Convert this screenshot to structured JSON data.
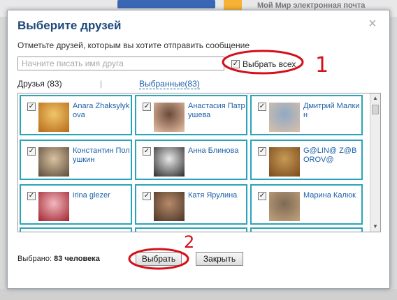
{
  "dialog": {
    "title": "Выберите друзей",
    "close_glyph": "×",
    "subtitle": "Отметьте друзей, которым вы хотите отправить сообщение",
    "search_placeholder": "Начните писать имя друга",
    "select_all_label": "Выбрать всех",
    "tab_friends": "Друзья (83)",
    "tab_separator": "|",
    "tab_selected": "Выбранные(83)"
  },
  "friends": [
    {
      "name": "Anara Zhaksylykova",
      "checked": true,
      "avatar_colors": [
        "#f0c66a",
        "#b86a18"
      ]
    },
    {
      "name": "Анастасия Патрушева",
      "checked": true,
      "avatar_colors": [
        "#6b4a3a",
        "#e8c1a5"
      ]
    },
    {
      "name": "Дмитрий Малкин",
      "checked": true,
      "avatar_colors": [
        "#8fa9c5",
        "#d9c0a8"
      ]
    },
    {
      "name": "Константин Полушкин",
      "checked": true,
      "avatar_colors": [
        "#d8c2a0",
        "#5c4a3a"
      ]
    },
    {
      "name": "Анна Блинова",
      "checked": true,
      "avatar_colors": [
        "#e9e9e9",
        "#2a2a2a"
      ]
    },
    {
      "name": "G@LIN@ Z@BOROV@",
      "checked": true,
      "avatar_colors": [
        "#c79a55",
        "#7a4a1e"
      ]
    },
    {
      "name": "irina glezer",
      "checked": true,
      "avatar_colors": [
        "#f2b8c0",
        "#a0242e"
      ]
    },
    {
      "name": "Катя Ярулина",
      "checked": true,
      "avatar_colors": [
        "#b78a6a",
        "#4a3526"
      ]
    },
    {
      "name": "Марина Калюк",
      "checked": true,
      "avatar_colors": [
        "#7e6a55",
        "#c2a27c"
      ]
    }
  ],
  "footer": {
    "selected_prefix": "Выбрано: ",
    "selected_value": "83 человека",
    "select_button": "Выбрать",
    "close_button": "Закрыть"
  },
  "annotations": {
    "mark_1": "1",
    "mark_2": "2",
    "color": "#d4101a"
  },
  "background": {
    "header_text": "Мой Мир    электронная почта"
  },
  "colors": {
    "title": "#1e4a7a",
    "link": "#1b5fa8",
    "tile_border": "#2aa4b8"
  }
}
